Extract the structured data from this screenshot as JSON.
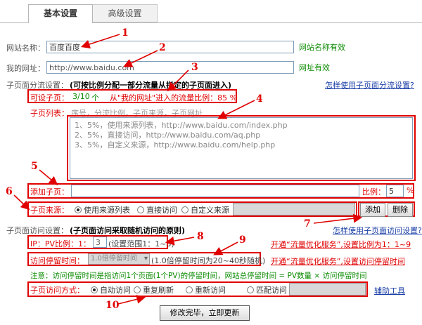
{
  "tabs": [
    {
      "label": "基本设置"
    },
    {
      "label": "高级设置"
    }
  ],
  "site_name": {
    "label": "网站名称：",
    "value": "百度百度",
    "status": "网站名称有效"
  },
  "site_url": {
    "label": "我的网址：",
    "value": "http://www.baidu.com",
    "status": "网址有效"
  },
  "split": {
    "label": "子页面分流设置：",
    "note": "(可按比例分配一部分流量从指定的子页面进入)",
    "help_link": "怎样使用子页面分流设置?",
    "configurable_label": "可设子页：",
    "configurable_value": "3/10",
    "configurable_unit": "个",
    "ratio_text": "从\"我的网址\"进入的流量比例：85 %",
    "list_label": "子页列表：",
    "list_header": "序号，分流比例，子页来源，子页网址",
    "list_items": [
      "1、5%，使用来源列表，http://www.baidu.com/index.php",
      "2、5%，直接访问，http://www.baidu.com/aq.php",
      "3、5%，自定义来源，http://www.baidu.com/help.php"
    ],
    "add_label": "添加子页：",
    "add_value": "",
    "ratio_label": "比例：",
    "ratio_value": "5",
    "ratio_unit": "%",
    "source_label": "子页来源：",
    "source_options": [
      "使用来源列表",
      "直接访问",
      "自定义来源"
    ],
    "add_button": "添加",
    "delete_button": "删除"
  },
  "visit": {
    "label": "子页面访问设置：",
    "note": "(子页面访问采取随机访问的原则)",
    "help_link": "怎样使用子页面访问设置?",
    "pv_label": "IP：PV比例：1：",
    "pv_value": "3",
    "pv_range": "(设置范围1：1~3)",
    "stay_label": "访问停留时间：",
    "stay_value": "1.0倍停留时间",
    "stay_note": "(1.0倍停留时间为20~40秒随机)",
    "promo_1": "开通“流量优化服务”,设置比例为1：1~9",
    "promo_2": "开通“流量优化服务”,设置访问停留时间",
    "notice": "注意：访问停留时间是指访问1个页面(1个PV)的停留时间，网站总停留时间 = PV数量 × 访问停留时间",
    "mode_label": "子页访问方式：",
    "mode_options": [
      "自动访问",
      "重复刷新",
      "重新访问",
      "匹配访问"
    ],
    "tool_link": "辅助工具",
    "submit": "修改完毕，立即更新"
  },
  "callouts": [
    "1",
    "2",
    "3",
    "4",
    "5",
    "6",
    "7",
    "8",
    "9",
    "10"
  ],
  "colors": {
    "accent": "#e00000",
    "ok": "#0a8a00",
    "link": "#1a3fa6"
  }
}
